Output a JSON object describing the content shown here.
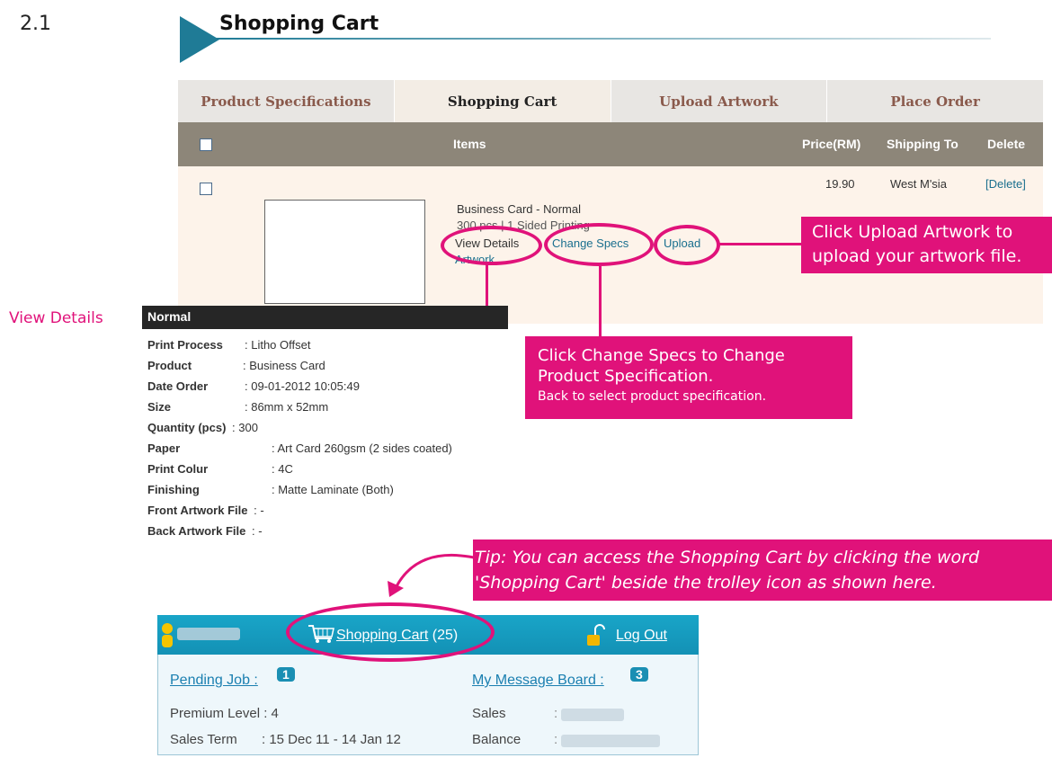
{
  "section_number": "2.1",
  "header": {
    "title": "Shopping Cart"
  },
  "tabs": [
    {
      "label": "Product Specifications"
    },
    {
      "label": "Shopping Cart"
    },
    {
      "label": "Upload Artwork"
    },
    {
      "label": "Place Order"
    }
  ],
  "table": {
    "headers": {
      "items": "Items",
      "price": "Price(RM)",
      "shipping": "Shipping To",
      "delete": "Delete"
    },
    "row": {
      "name": "Business Card - Normal",
      "qty_line": "300 pcs | 1 Sided Printing",
      "view_details": "View Details",
      "change_specs": "Change Specs",
      "upload": "Upload",
      "upload_cont": "Artwork",
      "price": "19.90",
      "shipping": "West M'sia",
      "delete": "[Delete]"
    }
  },
  "callouts": {
    "upload": [
      "Click Upload Artwork to",
      "upload your artwork file."
    ],
    "change_specs": [
      "Click Change Specs to Change",
      "Product Specification."
    ],
    "change_specs_sub": "Back to select product specification.",
    "view_details_label": "View Details",
    "tip": [
      "Tip: You can access the Shopping Cart by clicking the word",
      "'Shopping Cart' beside the trolley icon as shown here."
    ]
  },
  "details": {
    "title": "Normal",
    "rows": [
      {
        "label": "Print Process",
        "value": ": Litho Offset"
      },
      {
        "label": "Product",
        "value": ": Business Card"
      },
      {
        "label": "Date Order",
        "value": ": 09-01-2012 10:05:49"
      },
      {
        "label": "Size",
        "value": ": 86mm x 52mm"
      },
      {
        "label": "Quantity (pcs)",
        "value": ": 300"
      },
      {
        "label": "Paper",
        "value": ": Art Card 260gsm (2 sides coated)"
      },
      {
        "label": "Print Colur",
        "value": ": 4C"
      },
      {
        "label": "Finishing",
        "value": ": Matte Laminate (Both)"
      },
      {
        "label": "Front Artwork File",
        "value": ": -"
      },
      {
        "label": "Back Artwork File",
        "value": ": -"
      }
    ]
  },
  "widget": {
    "shopping_cart": "Shopping Cart",
    "cart_count": "(25)",
    "logout": "Log Out",
    "pending_job": "Pending Job :",
    "pending_count": "1",
    "message_board": "My Message Board :",
    "message_count": "3",
    "premium_level": "Premium Level : 4",
    "sales_label": "Sales",
    "sales_sep": ":",
    "sales_term_label": "Sales Term",
    "sales_term_value": ": 15 Dec 11 - 14 Jan 12",
    "balance_label": "Balance",
    "balance_sep": ":"
  },
  "colors": {
    "accent": "#e0127a",
    "teal": "#1f7b96",
    "header_bar": "#8d8679",
    "row_bg": "#fdf3ea"
  }
}
